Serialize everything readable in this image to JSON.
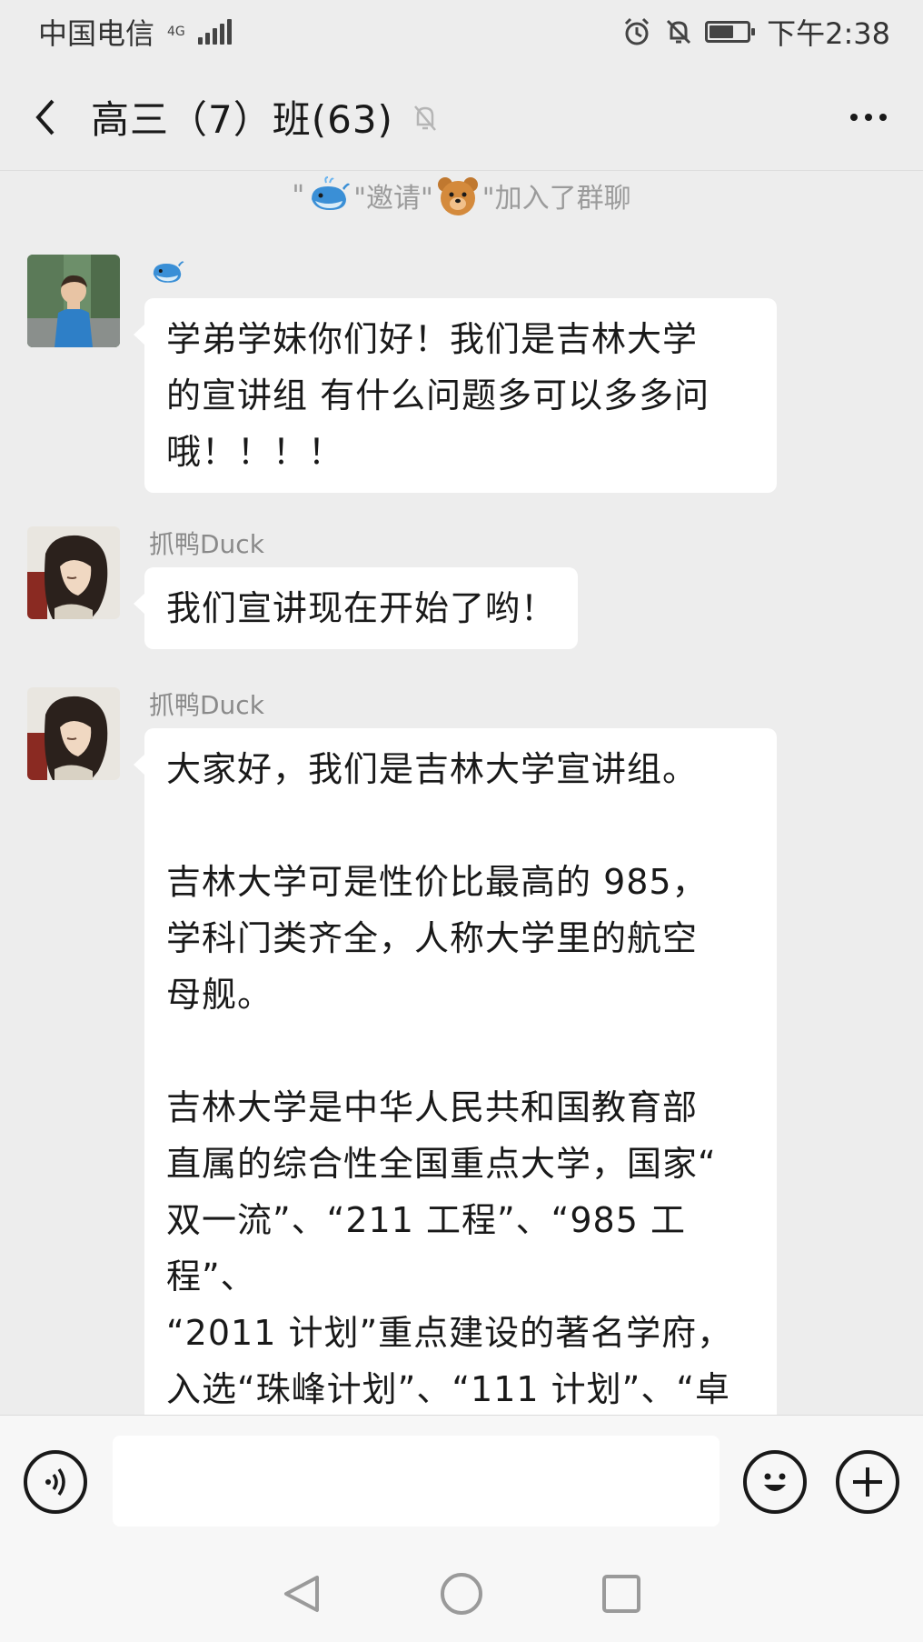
{
  "status_bar": {
    "carrier": "中国电信",
    "network": "4G",
    "time": "下午2:38"
  },
  "header": {
    "title": "高三（7）班(63)"
  },
  "system_message": {
    "quote_open": "\"",
    "mid_text": "\"邀请\"",
    "end_text": "\"加入了群聊"
  },
  "messages": [
    {
      "sender": "",
      "avatar": "boy-photo-avatar",
      "sender_icon": "whale-emoji",
      "text": "学弟学妹你们好！我们是吉林大学\n的宣讲组 有什么问题多可以多多问\n哦！！！！"
    },
    {
      "sender": "抓鸭Duck",
      "avatar": "anime-avatar",
      "text": "我们宣讲现在开始了哟！"
    },
    {
      "sender": "抓鸭Duck",
      "avatar": "anime-avatar",
      "text": "大家好，我们是吉林大学宣讲组。\n\n吉林大学可是性价比最高的 985，\n学科门类齐全，人称大学里的航空\n母舰。\n\n吉林大学是中华人民共和国教育部\n直属的综合性全国重点大学，国家“\n双一流”、“211 工程”、“985 工程”、\n“2011 计划”重点建设的著名学府，\n入选“珠峰计划”、“111 计划”、“卓\n越法律人才教育培养计划”、“卓越"
    }
  ],
  "input_bar": {
    "placeholder": ""
  },
  "icons": {
    "back": "back-arrow-icon",
    "mute": "bell-muted-icon",
    "more": "more-dots-icon",
    "voice": "voice-icon",
    "emoji": "emoji-face-icon",
    "plus": "plus-icon",
    "nav_back": "nav-back-triangle-icon",
    "nav_home": "nav-home-circle-icon",
    "nav_recent": "nav-recent-square-icon"
  },
  "colors": {
    "background": "#ededed",
    "bubble": "#ffffff",
    "text": "#191919",
    "muted_text": "#9b9b9b"
  }
}
